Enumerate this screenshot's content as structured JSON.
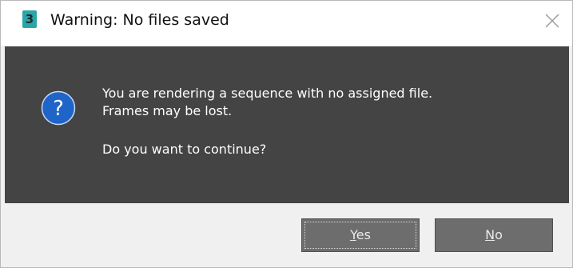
{
  "window": {
    "app_icon_text": "3",
    "title": "Warning: No files saved",
    "close_glyph": "×"
  },
  "message": {
    "line1": "You are rendering a sequence with no assigned file.",
    "line2": "Frames may be lost.",
    "line3": "Do you want to continue?",
    "icon": "question-icon",
    "icon_glyph": "?"
  },
  "buttons": {
    "yes": {
      "accel": "Y",
      "rest": "es",
      "focused": true
    },
    "no": {
      "accel": "N",
      "rest": "o",
      "focused": false
    }
  },
  "colors": {
    "content_bg": "#444444",
    "icon_blue": "#1f64c8",
    "button_bg": "#6d6d6d"
  }
}
